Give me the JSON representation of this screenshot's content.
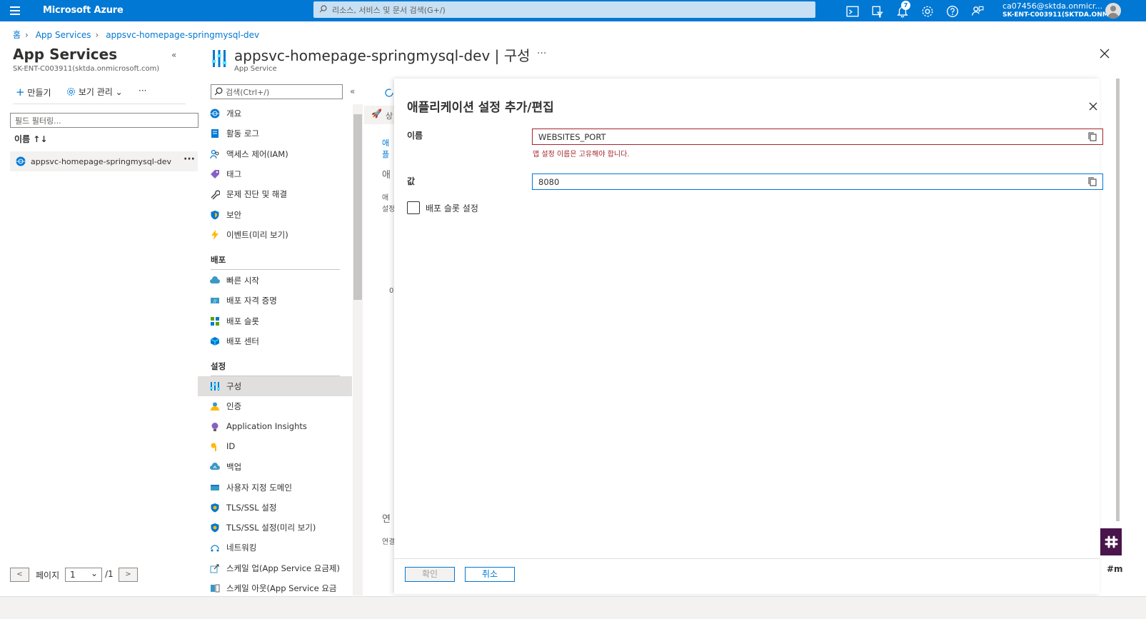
{
  "topbar": {
    "brand": "Microsoft Azure",
    "search_placeholder": "리소스, 서비스 및 문서 검색(G+/)",
    "notification_count": "7",
    "account_email": "ca07456@sktda.onmicr...",
    "account_tenant": "SK-ENT-C003911(SKTDA.ONM..."
  },
  "breadcrumb": {
    "home": "홈",
    "app_services": "App Services",
    "current": "appsvc-homepage-springmysql-dev"
  },
  "left_panel": {
    "title": "App Services",
    "subtitle": "SK-ENT-C003911(sktda.onmicrosoft.com)",
    "collapse": "«",
    "create_label": "만들기",
    "manage_view_label": "보기 관리",
    "more": "···",
    "filter_placeholder": "필드 필터링...",
    "column_name": "이름 ↑↓",
    "rows": [
      {
        "name": "appsvc-homepage-springmysql-dev",
        "more": "···"
      }
    ],
    "pager": {
      "prev": "<",
      "page_label": "페이지",
      "page_value": "1",
      "total": "/1",
      "next": ">"
    }
  },
  "resource": {
    "title": "appsvc-homepage-springmysql-dev | 구성",
    "type": "App Service",
    "more": "···"
  },
  "resource_menu": {
    "search_placeholder": "검색(Ctrl+/)",
    "collapse": "«",
    "items_general": [
      {
        "label": "개요",
        "icon": "globe-icon",
        "color": "#0078d4"
      },
      {
        "label": "활동 로그",
        "icon": "log-icon",
        "color": "#0078d4"
      },
      {
        "label": "액세스 제어(IAM)",
        "icon": "people-icon",
        "color": "#0078d4"
      },
      {
        "label": "태그",
        "icon": "tag-icon",
        "color": "#8661c5"
      },
      {
        "label": "문제 진단 및 해결",
        "icon": "wrench-icon",
        "color": "#323130"
      },
      {
        "label": "보안",
        "icon": "shield-icon",
        "color": "#0078d4"
      },
      {
        "label": "이벤트(미리 보기)",
        "icon": "lightning-icon",
        "color": "#ffb900"
      }
    ],
    "section_deploy": "배포",
    "items_deploy": [
      {
        "label": "빠른 시작",
        "icon": "cloud-icon",
        "color": "#3999c6"
      },
      {
        "label": "배포 자격 증명",
        "icon": "credentials-icon",
        "color": "#3999c6"
      },
      {
        "label": "배포 슬롯",
        "icon": "slots-icon",
        "color": "#57a300"
      },
      {
        "label": "배포 센터",
        "icon": "cube-icon",
        "color": "#0078d4"
      }
    ],
    "section_settings": "설정",
    "items_settings": [
      {
        "label": "구성",
        "icon": "config-icon",
        "color": "#0078d4",
        "selected": true
      },
      {
        "label": "인증",
        "icon": "user-icon",
        "color": "#3999c6"
      },
      {
        "label": "Application Insights",
        "icon": "lightbulb-icon",
        "color": "#8661c5"
      },
      {
        "label": "ID",
        "icon": "key-icon",
        "color": "#ffb900"
      },
      {
        "label": "백업",
        "icon": "backup-cloud-icon",
        "color": "#3999c6"
      },
      {
        "label": "사용자 지정 도메인",
        "icon": "domain-icon",
        "color": "#3999c6"
      },
      {
        "label": "TLS/SSL 설정",
        "icon": "tls-shield-icon",
        "color": "#0078d4"
      },
      {
        "label": "TLS/SSL 설정(미리 보기)",
        "icon": "tls-shield-icon",
        "color": "#0078d4"
      },
      {
        "label": "네트워킹",
        "icon": "network-icon",
        "color": "#3999c6"
      },
      {
        "label": "스케일 업(App Service 요금제)",
        "icon": "scale-up-icon",
        "color": "#3999c6"
      },
      {
        "label": "스케일 아웃(App Service 요금",
        "icon": "scale-out-icon",
        "color": "#3999c6"
      }
    ]
  },
  "behind": {
    "t1": "상",
    "t2": "애플",
    "t3": "애",
    "t4": "애",
    "t5": "설정",
    "t6": "0",
    "t7": "연",
    "t8": "연결"
  },
  "dialog": {
    "title": "애플리케이션 설정 추가/편집",
    "name_label": "이름",
    "name_value": "WEBSITES_PORT",
    "name_error": "앱 설정 이름은 고유해야 합니다.",
    "value_label": "값",
    "value_value": "8080",
    "slot_setting_label": "배포 슬롯 설정",
    "ok_label": "확인",
    "cancel_label": "취소"
  },
  "side_widget": {
    "text": "#m"
  }
}
